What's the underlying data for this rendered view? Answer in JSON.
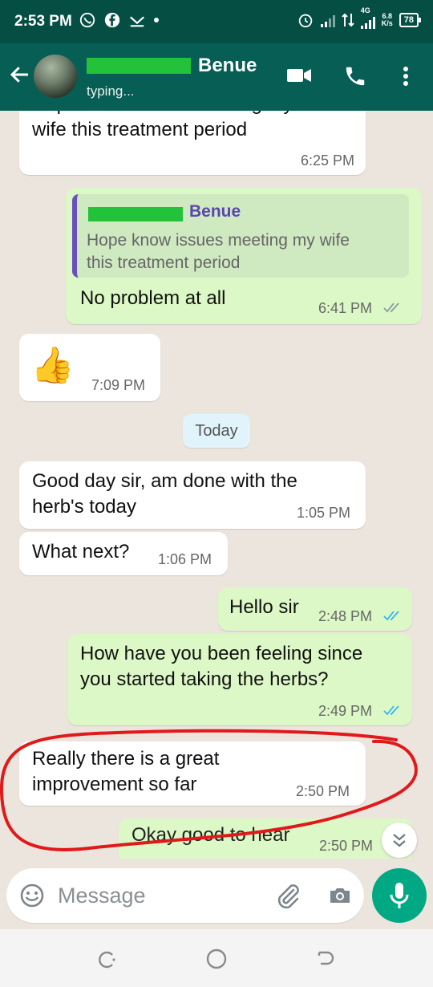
{
  "status_bar": {
    "time": "2:53 PM",
    "network": "4G",
    "speed_value": "6.8",
    "speed_unit": "K/s",
    "battery": "78"
  },
  "header": {
    "contact_name_visible": "Benue",
    "status": "typing...",
    "accent": "#075e54"
  },
  "messages": [
    {
      "dir": "in",
      "text": "Hope know issues meeting my\nwife this treatment period",
      "time": "6:25 PM"
    },
    {
      "dir": "out",
      "quote_name": "Benue",
      "quote_text": "Hope know issues meeting my wife\nthis treatment period",
      "text": "No problem at all",
      "time": "6:41 PM",
      "ticks": "read"
    },
    {
      "dir": "in",
      "emoji": "👍",
      "time": "7:09 PM"
    },
    {
      "date_chip": "Today"
    },
    {
      "dir": "in",
      "text": "Good day sir, am done with the\nherb's today",
      "time": "1:05 PM"
    },
    {
      "dir": "in",
      "text": "What next?",
      "time": "1:06 PM"
    },
    {
      "dir": "out",
      "text": "Hello sir",
      "time": "2:48 PM",
      "ticks": "read"
    },
    {
      "dir": "out",
      "text": "How have you been feeling since\nyou started taking the herbs?",
      "time": "2:49 PM",
      "ticks": "read"
    },
    {
      "dir": "in",
      "text": "Really there is a great\nimprovement so far",
      "time": "2:50 PM"
    },
    {
      "dir": "out",
      "text": "Okay good to hear",
      "time": "2:50 PM",
      "ticks": "read"
    }
  ],
  "composer": {
    "placeholder": "Message"
  },
  "colors": {
    "incoming": "#ffffff",
    "outgoing": "#dcf8c6",
    "read_tick": "#34b7f1",
    "mic": "#00a884",
    "annotation": "#e0191b"
  }
}
